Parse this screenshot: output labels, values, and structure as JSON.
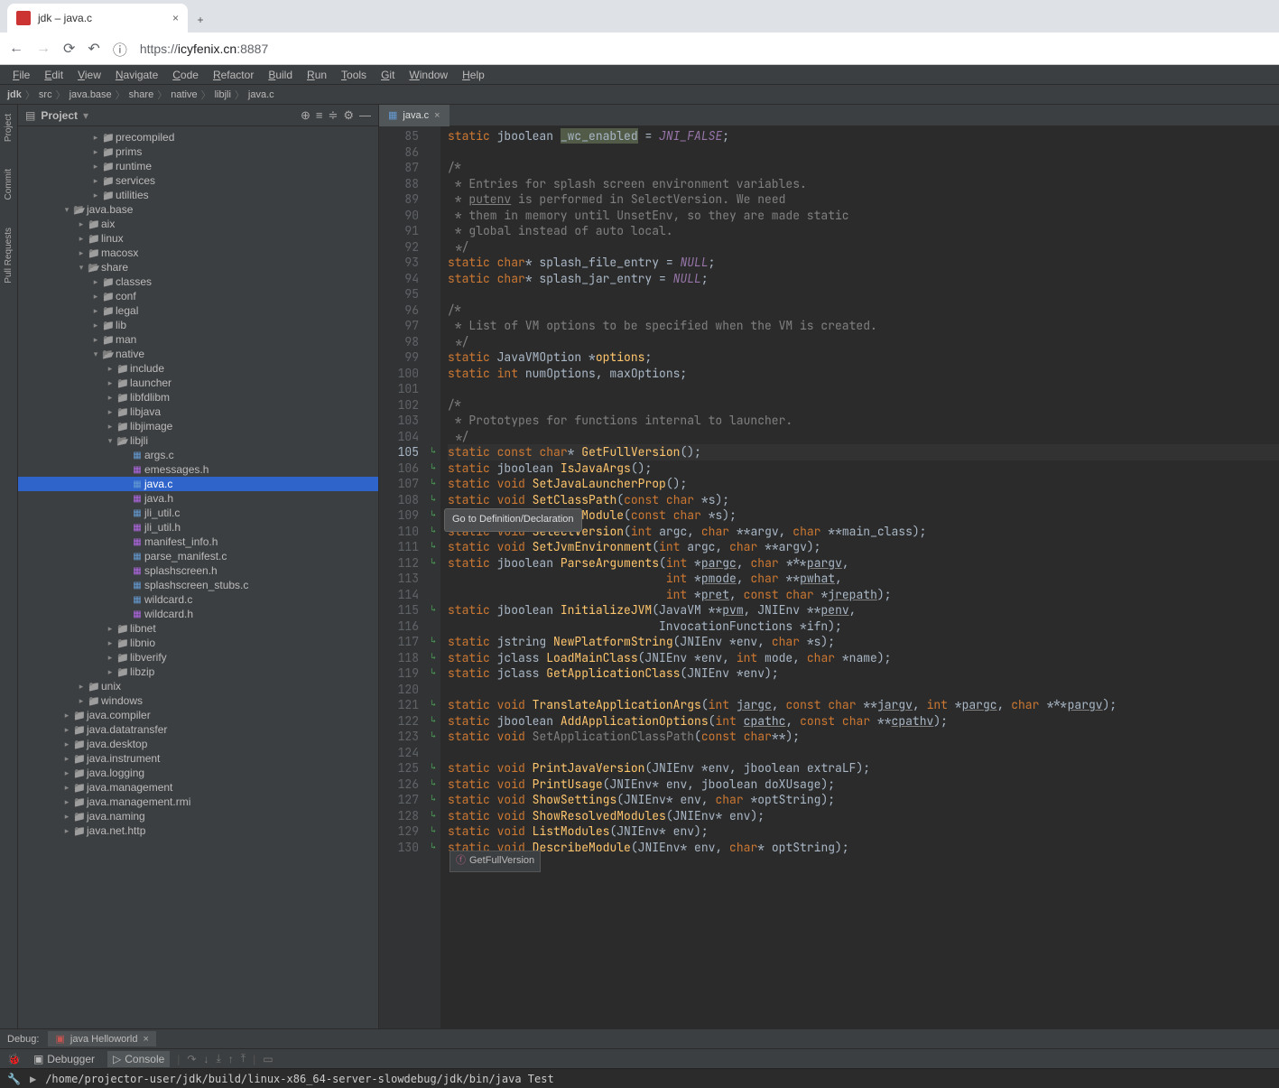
{
  "browser": {
    "tab_title": "jdk – java.c",
    "url_scheme": "https://",
    "url_host": "icyfenix.cn",
    "url_port": ":8887"
  },
  "menubar": [
    "File",
    "Edit",
    "View",
    "Navigate",
    "Code",
    "Refactor",
    "Build",
    "Run",
    "Tools",
    "Git",
    "Window",
    "Help"
  ],
  "breadcrumb": [
    "jdk",
    "src",
    "java.base",
    "share",
    "native",
    "libjli",
    "java.c"
  ],
  "panel_title": "Project",
  "tree": [
    {
      "d": 5,
      "a": ">",
      "i": "folder",
      "t": "precompiled"
    },
    {
      "d": 5,
      "a": ">",
      "i": "folder",
      "t": "prims"
    },
    {
      "d": 5,
      "a": ">",
      "i": "folder",
      "t": "runtime"
    },
    {
      "d": 5,
      "a": ">",
      "i": "folder",
      "t": "services"
    },
    {
      "d": 5,
      "a": ">",
      "i": "folder",
      "t": "utilities"
    },
    {
      "d": 3,
      "a": "v",
      "i": "folder-open",
      "t": "java.base"
    },
    {
      "d": 4,
      "a": ">",
      "i": "folder",
      "t": "aix"
    },
    {
      "d": 4,
      "a": ">",
      "i": "folder",
      "t": "linux"
    },
    {
      "d": 4,
      "a": ">",
      "i": "folder",
      "t": "macosx"
    },
    {
      "d": 4,
      "a": "v",
      "i": "folder-open",
      "t": "share"
    },
    {
      "d": 5,
      "a": ">",
      "i": "folder",
      "t": "classes"
    },
    {
      "d": 5,
      "a": ">",
      "i": "folder",
      "t": "conf"
    },
    {
      "d": 5,
      "a": ">",
      "i": "folder",
      "t": "legal"
    },
    {
      "d": 5,
      "a": ">",
      "i": "folder",
      "t": "lib"
    },
    {
      "d": 5,
      "a": ">",
      "i": "folder",
      "t": "man"
    },
    {
      "d": 5,
      "a": "v",
      "i": "folder-open",
      "t": "native"
    },
    {
      "d": 6,
      "a": ">",
      "i": "folder",
      "t": "include"
    },
    {
      "d": 6,
      "a": ">",
      "i": "folder",
      "t": "launcher"
    },
    {
      "d": 6,
      "a": ">",
      "i": "folder",
      "t": "libfdlibm"
    },
    {
      "d": 6,
      "a": ">",
      "i": "folder",
      "t": "libjava"
    },
    {
      "d": 6,
      "a": ">",
      "i": "folder",
      "t": "libjimage"
    },
    {
      "d": 6,
      "a": "v",
      "i": "folder-open",
      "t": "libjli"
    },
    {
      "d": 7,
      "a": " ",
      "i": "cfile",
      "t": "args.c"
    },
    {
      "d": 7,
      "a": " ",
      "i": "hfile",
      "t": "emessages.h"
    },
    {
      "d": 7,
      "a": " ",
      "i": "cfile",
      "t": "java.c",
      "sel": true
    },
    {
      "d": 7,
      "a": " ",
      "i": "hfile",
      "t": "java.h"
    },
    {
      "d": 7,
      "a": " ",
      "i": "cfile",
      "t": "jli_util.c"
    },
    {
      "d": 7,
      "a": " ",
      "i": "hfile",
      "t": "jli_util.h"
    },
    {
      "d": 7,
      "a": " ",
      "i": "hfile",
      "t": "manifest_info.h"
    },
    {
      "d": 7,
      "a": " ",
      "i": "cfile",
      "t": "parse_manifest.c"
    },
    {
      "d": 7,
      "a": " ",
      "i": "hfile",
      "t": "splashscreen.h"
    },
    {
      "d": 7,
      "a": " ",
      "i": "cfile",
      "t": "splashscreen_stubs.c"
    },
    {
      "d": 7,
      "a": " ",
      "i": "cfile",
      "t": "wildcard.c"
    },
    {
      "d": 7,
      "a": " ",
      "i": "hfile",
      "t": "wildcard.h"
    },
    {
      "d": 6,
      "a": ">",
      "i": "folder",
      "t": "libnet"
    },
    {
      "d": 6,
      "a": ">",
      "i": "folder",
      "t": "libnio"
    },
    {
      "d": 6,
      "a": ">",
      "i": "folder",
      "t": "libverify"
    },
    {
      "d": 6,
      "a": ">",
      "i": "folder",
      "t": "libzip"
    },
    {
      "d": 4,
      "a": ">",
      "i": "folder",
      "t": "unix"
    },
    {
      "d": 4,
      "a": ">",
      "i": "folder",
      "t": "windows"
    },
    {
      "d": 3,
      "a": ">",
      "i": "folder",
      "t": "java.compiler"
    },
    {
      "d": 3,
      "a": ">",
      "i": "folder",
      "t": "java.datatransfer"
    },
    {
      "d": 3,
      "a": ">",
      "i": "folder",
      "t": "java.desktop"
    },
    {
      "d": 3,
      "a": ">",
      "i": "folder",
      "t": "java.instrument"
    },
    {
      "d": 3,
      "a": ">",
      "i": "folder",
      "t": "java.logging"
    },
    {
      "d": 3,
      "a": ">",
      "i": "folder",
      "t": "java.management"
    },
    {
      "d": 3,
      "a": ">",
      "i": "folder",
      "t": "java.management.rmi"
    },
    {
      "d": 3,
      "a": ">",
      "i": "folder",
      "t": "java.naming"
    },
    {
      "d": 3,
      "a": ">",
      "i": "folder",
      "t": "java.net.http"
    }
  ],
  "open_file_tab": "java.c",
  "tooltip": "Go to Definition/Declaration",
  "hint": "GetFullVersion",
  "code_lines": [
    {
      "n": 85,
      "html": "<span class='kw'>static</span> jboolean <span class='boxed'>_wc_enabled</span> = <span class='mac'>JNI_FALSE</span>;"
    },
    {
      "n": 86,
      "html": ""
    },
    {
      "n": 87,
      "html": "<span class='cm'>/*</span>"
    },
    {
      "n": 88,
      "html": "<span class='cm'> * Entries for splash screen environment variables.</span>"
    },
    {
      "n": 89,
      "html": "<span class='cm'> * <span class='underline'>putenv</span> is performed in SelectVersion. We need</span>"
    },
    {
      "n": 90,
      "html": "<span class='cm'> * them in memory until UnsetEnv, so they are made static</span>"
    },
    {
      "n": 91,
      "html": "<span class='cm'> * global instead of auto local.</span>"
    },
    {
      "n": 92,
      "html": "<span class='cm'> */</span>"
    },
    {
      "n": 93,
      "html": "<span class='kw'>static</span> <span class='kw'>char</span>* splash_file_entry = <span class='mac'>NULL</span>;"
    },
    {
      "n": 94,
      "html": "<span class='kw'>static</span> <span class='kw'>char</span>* splash_jar_entry = <span class='mac'>NULL</span>;"
    },
    {
      "n": 95,
      "html": ""
    },
    {
      "n": 96,
      "html": "<span class='cm'>/*</span>"
    },
    {
      "n": 97,
      "html": "<span class='cm'> * List of VM options to be specified when the VM is created.</span>"
    },
    {
      "n": 98,
      "html": "<span class='cm'> */</span>"
    },
    {
      "n": 99,
      "html": "<span class='kw'>static</span> JavaVMOption *<span class='fn'>options</span>;"
    },
    {
      "n": 100,
      "html": "<span class='kw'>static</span> <span class='kw'>int</span> numOptions, maxOptions;"
    },
    {
      "n": 101,
      "html": ""
    },
    {
      "n": 102,
      "html": "<span class='cm'>/*</span>"
    },
    {
      "n": 103,
      "html": "<span class='cm'> * Prototypes for functions internal to launcher.</span>"
    },
    {
      "n": 104,
      "html": "<span class='cm'> */</span>"
    },
    {
      "n": 105,
      "html": "<span class='kw'>static</span> <span class='kw'>const</span> <span class='kw'>char</span>* <span class='fn'>GetFullVersion</span>();",
      "caret": true
    },
    {
      "n": 106,
      "html": "<span class='kw'>static</span> jboolean <span class='fn'>IsJavaArgs</span>();"
    },
    {
      "n": 107,
      "html": "<span class='kw'>static</span> <span class='kw'>void</span> <span class='fn'>SetJavaLauncherProp</span>();"
    },
    {
      "n": 108,
      "html": "<span class='kw'>static</span> <span class='kw'>void</span> <span class='fn'>SetClassPath</span>(<span class='kw'>const</span> <span class='kw'>char</span> *s);"
    },
    {
      "n": 109,
      "html": "<span class='kw'>static</span> <span class='kw'>void</span> <span class='fn'>SetMainModule</span>(<span class='kw'>const</span> <span class='kw'>char</span> *s);"
    },
    {
      "n": 110,
      "html": "<span class='kw'>static</span> <span class='kw'>void</span> <span class='fn'>SelectVersion</span>(<span class='kw'>int</span> argc, <span class='kw'>char</span> **argv, <span class='kw'>char</span> **main_class);"
    },
    {
      "n": 111,
      "html": "<span class='kw'>static</span> <span class='kw'>void</span> <span class='fn'>SetJvmEnvironment</span>(<span class='kw'>int</span> argc, <span class='kw'>char</span> **argv);"
    },
    {
      "n": 112,
      "html": "<span class='kw'>static</span> jboolean <span class='fn'>ParseArguments</span>(<span class='kw'>int</span> *<span class='underline'>pargc</span>, <span class='kw'>char</span> ***<span class='underline'>pargv</span>,"
    },
    {
      "n": 113,
      "html": "                               <span class='kw'>int</span> *<span class='underline'>pmode</span>, <span class='kw'>char</span> **<span class='underline'>pwhat</span>,"
    },
    {
      "n": 114,
      "html": "                               <span class='kw'>int</span> *<span class='underline'>pret</span>, <span class='kw'>const</span> <span class='kw'>char</span> *<span class='underline'>jrepath</span>);"
    },
    {
      "n": 115,
      "html": "<span class='kw'>static</span> jboolean <span class='fn'>InitializeJVM</span>(JavaVM **<span class='underline'>pvm</span>, JNIEnv **<span class='underline'>penv</span>,"
    },
    {
      "n": 116,
      "html": "                              InvocationFunctions *ifn);"
    },
    {
      "n": 117,
      "html": "<span class='kw'>static</span> jstring <span class='fn'>NewPlatformString</span>(JNIEnv *env, <span class='kw'>char</span> *s);"
    },
    {
      "n": 118,
      "html": "<span class='kw'>static</span> jclass <span class='fn'>LoadMainClass</span>(JNIEnv *env, <span class='kw'>int</span> mode, <span class='kw'>char</span> *name);"
    },
    {
      "n": 119,
      "html": "<span class='kw'>static</span> jclass <span class='fn'>GetApplicationClass</span>(JNIEnv *env);"
    },
    {
      "n": 120,
      "html": ""
    },
    {
      "n": 121,
      "html": "<span class='kw'>static</span> <span class='kw'>void</span> <span class='fn'>TranslateApplicationArgs</span>(<span class='kw'>int</span> <span class='underline'>jargc</span>, <span class='kw'>const</span> <span class='kw'>char</span> **<span class='underline'>jargv</span>, <span class='kw'>int</span> *<span class='underline'>pargc</span>, <span class='kw'>char</span> ***<span class='underline'>pargv</span>);"
    },
    {
      "n": 122,
      "html": "<span class='kw'>static</span> jboolean <span class='fn'>AddApplicationOptions</span>(<span class='kw'>int</span> <span class='underline'>cpathc</span>, <span class='kw'>const</span> <span class='kw'>char</span> **<span class='underline'>cpathv</span>);"
    },
    {
      "n": 123,
      "html": "<span class='kw'>static</span> <span class='kw'>void</span> <span class='cm'>SetApplicationClassPath</span>(<span class='kw'>const</span> <span class='kw'>char</span>**);"
    },
    {
      "n": 124,
      "html": ""
    },
    {
      "n": 125,
      "html": "<span class='kw'>static</span> <span class='kw'>void</span> <span class='fn'>PrintJavaVersion</span>(JNIEnv *env, jboolean extraLF);"
    },
    {
      "n": 126,
      "html": "<span class='kw'>static</span> <span class='kw'>void</span> <span class='fn'>PrintUsage</span>(JNIEnv* env, jboolean doXUsage);"
    },
    {
      "n": 127,
      "html": "<span class='kw'>static</span> <span class='kw'>void</span> <span class='fn'>ShowSettings</span>(JNIEnv* env, <span class='kw'>char</span> *optString);"
    },
    {
      "n": 128,
      "html": "<span class='kw'>static</span> <span class='kw'>void</span> <span class='fn'>ShowResolvedModules</span>(JNIEnv* env);"
    },
    {
      "n": 129,
      "html": "<span class='kw'>static</span> <span class='kw'>void</span> <span class='fn'>ListModules</span>(JNIEnv* env);"
    },
    {
      "n": 130,
      "html": "<span class='kw'>static</span> <span class='kw'>void</span> <span class='fn'>DescribeModule</span>(JNIEnv* env, <span class='kw'>char</span>* optString);"
    }
  ],
  "left_rail": [
    "Project",
    "Commit",
    "Pull Requests"
  ],
  "debug_label": "Debug:",
  "debug_tab": "java Helloworld",
  "debugger_tab": "Debugger",
  "console_tab": "Console",
  "cmd": "/home/projector-user/jdk/build/linux-x86_64-server-slowdebug/jdk/bin/java Test"
}
